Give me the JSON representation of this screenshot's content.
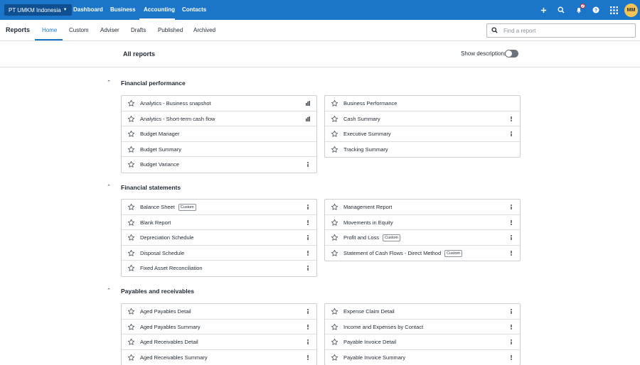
{
  "topbar": {
    "org_name": "PT UMKM Indonesia",
    "nav": [
      {
        "label": "Dashboard"
      },
      {
        "label": "Business"
      },
      {
        "label": "Accounting"
      },
      {
        "label": "Contacts"
      }
    ],
    "notification_count": "2",
    "avatar_initials": "MM"
  },
  "subnav": {
    "title": "Reports",
    "tabs": [
      {
        "label": "Home"
      },
      {
        "label": "Custom"
      },
      {
        "label": "Adviser"
      },
      {
        "label": "Drafts"
      },
      {
        "label": "Published"
      },
      {
        "label": "Archived"
      }
    ],
    "search_placeholder": "Find a report"
  },
  "header": {
    "title": "All reports",
    "show_descriptions_label": "Show descriptions"
  },
  "custom_tag": "Custom",
  "sections": [
    {
      "title": "Financial performance",
      "left": [
        {
          "name": "Analytics - Business snapshot",
          "action": "bar"
        },
        {
          "name": "Analytics - Short-term cash flow",
          "action": "bar"
        },
        {
          "name": "Budget Manager",
          "action": "none"
        },
        {
          "name": "Budget Summary",
          "action": "none"
        },
        {
          "name": "Budget Variance",
          "action": "more"
        }
      ],
      "right": [
        {
          "name": "Business Performance",
          "action": "none"
        },
        {
          "name": "Cash Summary",
          "action": "more"
        },
        {
          "name": "Executive Summary",
          "action": "more"
        },
        {
          "name": "Tracking Summary",
          "action": "none"
        }
      ]
    },
    {
      "title": "Financial statements",
      "left": [
        {
          "name": "Balance Sheet",
          "action": "more",
          "custom": true
        },
        {
          "name": "Blank Report",
          "action": "more"
        },
        {
          "name": "Depreciation Schedule",
          "action": "more"
        },
        {
          "name": "Disposal Schedule",
          "action": "more"
        },
        {
          "name": "Fixed Asset Reconciliation",
          "action": "more"
        }
      ],
      "right": [
        {
          "name": "Management Report",
          "action": "more"
        },
        {
          "name": "Movements in Equity",
          "action": "more"
        },
        {
          "name": "Profit and Loss",
          "action": "more",
          "custom": true
        },
        {
          "name": "Statement of Cash Flows - Direct Method",
          "action": "more",
          "custom": true
        }
      ]
    },
    {
      "title": "Payables and receivables",
      "left": [
        {
          "name": "Aged Payables Detail",
          "action": "more"
        },
        {
          "name": "Aged Payables Summary",
          "action": "more"
        },
        {
          "name": "Aged Receivables Detail",
          "action": "more"
        },
        {
          "name": "Aged Receivables Summary",
          "action": "more"
        }
      ],
      "right": [
        {
          "name": "Expense Claim Detail",
          "action": "more"
        },
        {
          "name": "Income and Expenses by Contact",
          "action": "more"
        },
        {
          "name": "Payable Invoice Detail",
          "action": "more"
        },
        {
          "name": "Payable Invoice Summary",
          "action": "more"
        }
      ]
    }
  ],
  "colors": {
    "brand_blue": "#1b76c9",
    "org_button": "#0e4f91",
    "avatar": "#f2c357"
  }
}
